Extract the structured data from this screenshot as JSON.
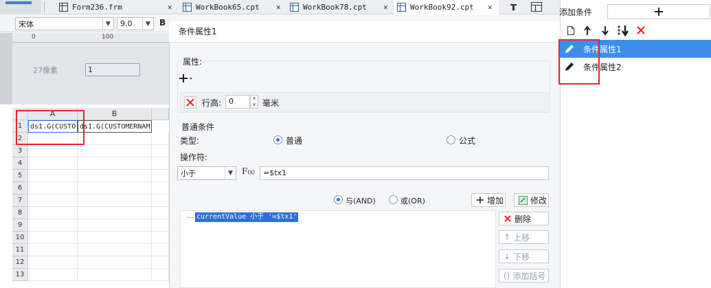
{
  "tabs": [
    {
      "label": "Form236.frm"
    },
    {
      "label": "WorkBook65.cpt"
    },
    {
      "label": "WorkBook78.cpt"
    },
    {
      "label": "WorkBook92.cpt"
    }
  ],
  "toolbar": {
    "font_name": "宋体",
    "font_size": "9.0",
    "bold_label": "B"
  },
  "design": {
    "ruler_0": "0",
    "ruler_100": "100",
    "row_height_label": "27像素",
    "box_value": "1"
  },
  "sheet": {
    "columns": [
      "A",
      "B"
    ],
    "rows": [
      "1",
      "2",
      "3",
      "4",
      "5",
      "6",
      "7",
      "8",
      "9",
      "10",
      "11",
      "12",
      "13"
    ],
    "cell_a1": "ds1.G(CUSTO",
    "cell_b1": "ds1.G(CUSTOMERNAM"
  },
  "dialog": {
    "title": "条件属性1",
    "attr_section": "属性:",
    "row_height_label": "行高:",
    "row_height_value": "0",
    "unit_label": "毫米",
    "normal_section": "普通条件",
    "type_label": "类型:",
    "type_normal": "普通",
    "type_formula": "公式",
    "operator_label": "操作符:",
    "operator_value": "小于",
    "formula_value": "=$tx1",
    "and_label": "与(AND)",
    "or_label": "或(OR)",
    "add_label": "增加",
    "modify_label": "修改",
    "condition_text": "currentValue 小于 '=$tx1'",
    "delete_label": "删除",
    "move_up_label": "上移",
    "move_down_label": "下移",
    "add_bracket_label": "添加括号"
  },
  "rpanel": {
    "header": "添加条件",
    "items": [
      {
        "label": "条件属性1"
      },
      {
        "label": "条件属性2"
      }
    ]
  },
  "colors": {
    "accent": "#3d8eea",
    "danger": "#e8262a",
    "selection": "#2f6fd6"
  }
}
